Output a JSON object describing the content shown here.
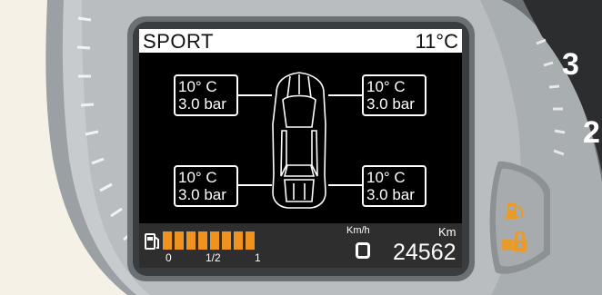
{
  "header": {
    "mode": "SPORT",
    "outside_temp": "11°C"
  },
  "tires": {
    "front_left": {
      "temp": "10° C",
      "pressure": "3.0 bar"
    },
    "front_right": {
      "temp": "10° C",
      "pressure": "3.0 bar"
    },
    "rear_left": {
      "temp": "10° C",
      "pressure": "3.0 bar"
    },
    "rear_right": {
      "temp": "10° C",
      "pressure": "3.0 bar"
    }
  },
  "fuel": {
    "level": 1.0,
    "segments": 8,
    "scale_labels": [
      "0",
      "1/2",
      "1"
    ],
    "bar_color": "#f0921e"
  },
  "speed": {
    "unit": "Km/h",
    "value": "0"
  },
  "odometer": {
    "unit": "Km",
    "value": "24562"
  },
  "tach_numbers": [
    "3",
    "2"
  ],
  "warning_lights": [
    "fuel-warning-icon",
    "lock-warning-icon"
  ],
  "colors": {
    "warning": "#e89a2a",
    "bezel": "#b8bcbf"
  }
}
